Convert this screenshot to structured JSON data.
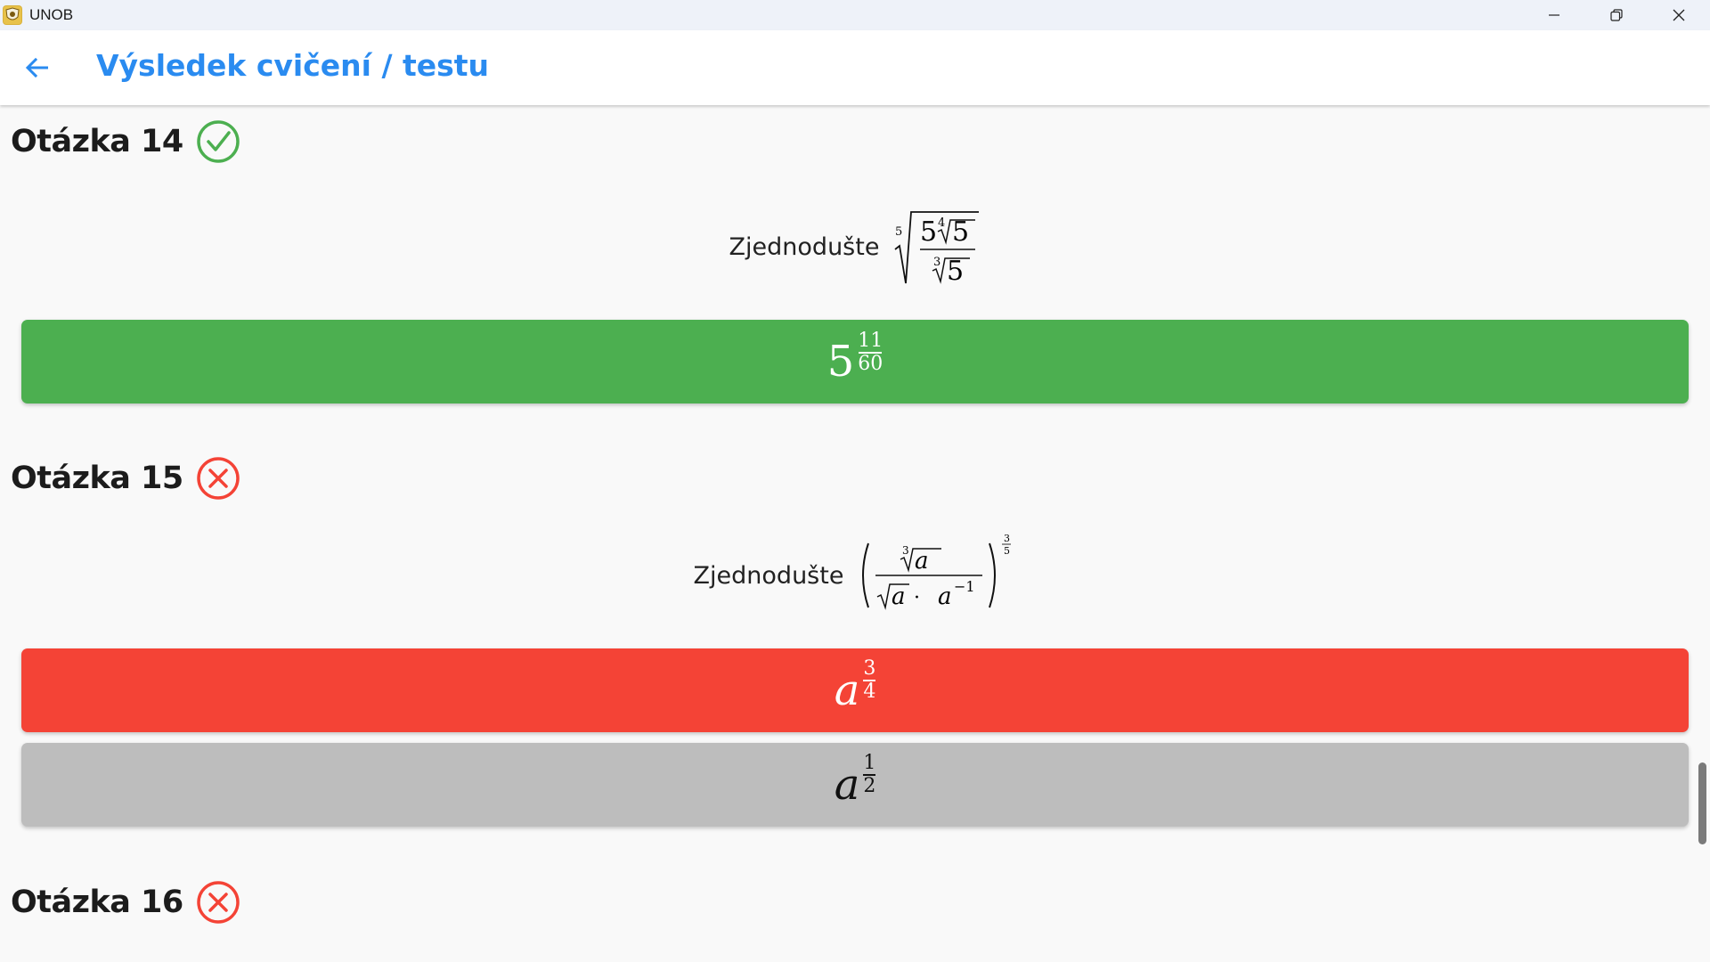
{
  "window": {
    "title": "UNOB",
    "icon": "unob-crest-icon",
    "controls": [
      "minimize-icon",
      "restore-icon",
      "close-icon"
    ]
  },
  "header": {
    "back_icon": "arrow-left-icon",
    "title": "Výsledek cvičení / testu"
  },
  "colors": {
    "accent": "#2a8bf0",
    "correct": "#4caf50",
    "wrong": "#f44336",
    "neutral": "#bdbdbd"
  },
  "questions": [
    {
      "label": "Otázka 14",
      "status": "correct",
      "status_icon": "check-circle-icon",
      "prompt": "Zjednodušte",
      "expression": {
        "outer_root_index": "5",
        "num_coeff": "5",
        "num_root_index": "4",
        "num_radicand": "5",
        "den_root_index": "3",
        "den_radicand": "5"
      },
      "answers": [
        {
          "state": "selected-correct",
          "base": "5",
          "exp_num": "11",
          "exp_den": "60"
        }
      ]
    },
    {
      "label": "Otázka 15",
      "status": "wrong",
      "status_icon": "x-circle-icon",
      "prompt": "Zjednodušte",
      "expression": {
        "num_root_index": "3",
        "num_radicand": "a",
        "den_radicand": "a",
        "den_dot": "·",
        "den_power_base": "a",
        "den_power_exp": "−1",
        "outer_exp_num": "3",
        "outer_exp_den": "5"
      },
      "answers": [
        {
          "state": "selected-wrong",
          "base": "a",
          "exp_num": "3",
          "exp_den": "4"
        },
        {
          "state": "correct-answer",
          "base": "a",
          "exp_num": "1",
          "exp_den": "2"
        }
      ]
    },
    {
      "label": "Otázka 16",
      "status": "wrong",
      "status_icon": "x-circle-icon"
    }
  ]
}
